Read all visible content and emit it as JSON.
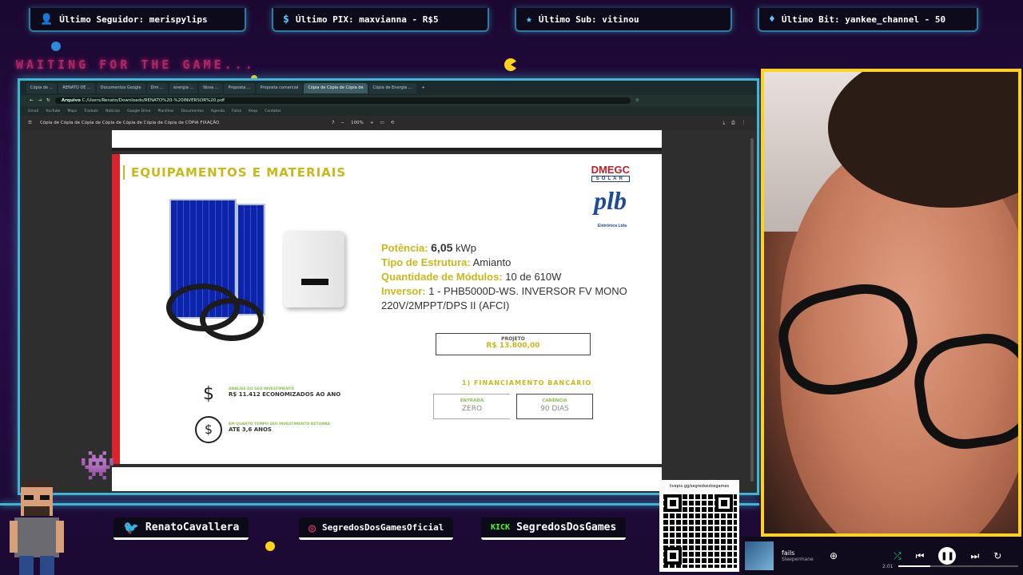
{
  "overlay": {
    "alerts": [
      {
        "icon": "user-icon",
        "label": "Último Seguidor: merispylips"
      },
      {
        "icon": "dollar-icon",
        "label": "Último PIX: maxvianna - R$5"
      },
      {
        "icon": "star-icon",
        "label": "Último Sub: vitinou"
      },
      {
        "icon": "diamond-icon",
        "label": "Último Bit: yankee_channel - 50"
      }
    ],
    "waiting_text": "WAITING FOR THE GAME...",
    "social": {
      "twitter": "RenatoCavallera",
      "instagram": "SegredosDosGamesOficial",
      "kick_brand": "KICK",
      "kick": "SegredosDosGames"
    },
    "qr_url": "livepix.gg/segredosdosgames",
    "colors": {
      "frame": "#3fb5d6",
      "cam_border": "#ffd21c",
      "accent_pink": "#ff2a7a"
    }
  },
  "player": {
    "song": "fails",
    "artist": "Sleepermane",
    "time": "2:01"
  },
  "browser": {
    "tabs": [
      "Cópia de ...",
      "RENATO DE ...",
      "Documentos Google",
      "Dim ...",
      "energia ...",
      "Nova ...",
      "Proposta ...",
      "Proposta comercial",
      "Cópia de Cópia de Cópia de",
      "Cópia de Energia ..."
    ],
    "active_tab": 8,
    "address_prefix": "Arquivo",
    "url": "C:/Users/Renato/Downloads/RENATO%20-%20INVERSOR%20.pdf",
    "bookmarks": [
      "Gmail",
      "YouTube",
      "Maps",
      "Traduzir",
      "Notícias",
      "Google Drive",
      "Planilhas",
      "Documentos",
      "Agenda",
      "Fotos",
      "Keep",
      "Contatos"
    ],
    "pdf_title": "Cópia de Cópia de Cópia de Cópia de Cópia de Cópia de Cópia de CÓPIA FIXAÇÃO",
    "pdf_page": "7",
    "pdf_zoom": "100%"
  },
  "pdf": {
    "title": "EQUIPAMENTOS E MATERIAIS",
    "logo_brand": "DMEGC",
    "logo_sub": "SOLAR",
    "logo2": "plb",
    "logo2_sub": "Eletrônica Ltda",
    "specs": [
      {
        "label": "Potência:",
        "value": "6,05",
        "unit": "kWp"
      },
      {
        "label": "Tipo de Estrutura:",
        "value": "Amianto"
      },
      {
        "label": "Quantidade de Módulos:",
        "value": "10 de 610W"
      },
      {
        "label": "Inversor:",
        "value": "1 - PHB5000D-WS. INVERSOR FV MONO 220V/2MPPT/DPS II (AFCI)"
      }
    ],
    "projeto_label": "PROJETO",
    "projeto_value": "R$ 13.800,00",
    "financing_title": "1) FINANCIAMENTO BANCÁRIO",
    "entrada_label": "ENTRADA",
    "entrada_value": "ZERO",
    "carencia_label": "CARÊNCIA",
    "carencia_value": "90 DIAS",
    "economy_small": "ANÁLISE DO SEU INVESTIMENTO",
    "economy_value": "R$ 11.412 ECONOMIZADOS AO ANO",
    "return_small": "EM QUANTO TEMPO SEU INVESTIMENTO RETORNA",
    "return_value": "ATÉ 3,6 ANOS"
  }
}
